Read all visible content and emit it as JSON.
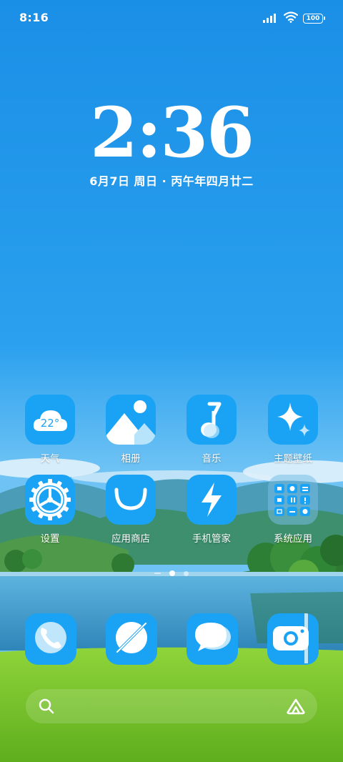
{
  "status_bar": {
    "time": "8:16",
    "battery": "100"
  },
  "clock": {
    "time": "2:36",
    "date": "6月7日 周日 · 丙午年四月廿二"
  },
  "weather": {
    "temp": "22°"
  },
  "apps": [
    {
      "label": "天气",
      "icon": "weather-icon"
    },
    {
      "label": "相册",
      "icon": "gallery-icon"
    },
    {
      "label": "音乐",
      "icon": "music-icon"
    },
    {
      "label": "主题壁纸",
      "icon": "themes-icon"
    },
    {
      "label": "设置",
      "icon": "settings-gear-icon"
    },
    {
      "label": "应用商店",
      "icon": "app-store-icon"
    },
    {
      "label": "手机管家",
      "icon": "security-bolt-icon"
    },
    {
      "label": "系统应用",
      "icon": "folder-icon"
    }
  ],
  "dock": [
    {
      "icon": "phone-icon"
    },
    {
      "icon": "browser-icon"
    },
    {
      "icon": "messages-icon"
    },
    {
      "icon": "camera-icon"
    }
  ],
  "page_indicator": {
    "pages": 2,
    "current": 1
  },
  "colors": {
    "icon_bg": "#1aa3f5",
    "sky_top": "#1a8fe6",
    "grass": "#7fcb2e"
  }
}
